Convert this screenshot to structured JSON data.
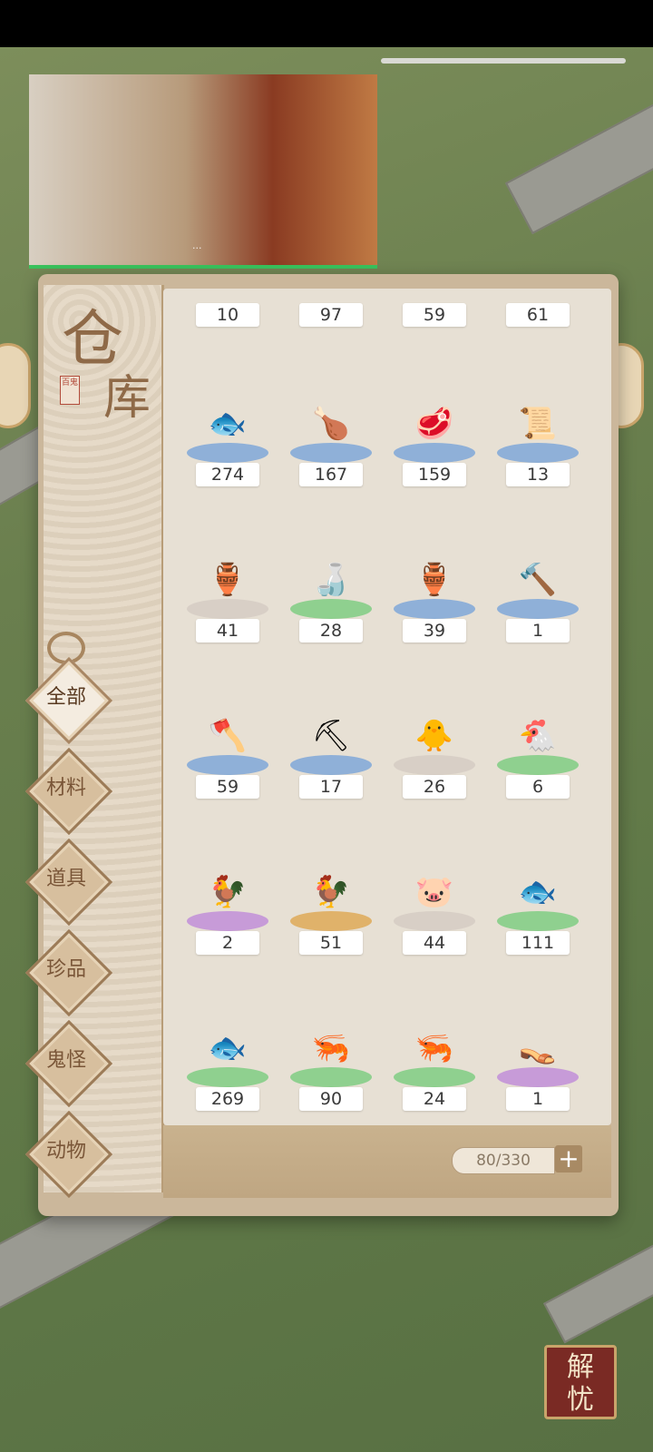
{
  "warehouse": {
    "title_char_1": "仓",
    "title_char_2": "库",
    "seal_text": "百鬼"
  },
  "tabs": [
    {
      "label": "全部",
      "active": true
    },
    {
      "label": "材料",
      "active": false
    },
    {
      "label": "道具",
      "active": false
    },
    {
      "label": "珍品",
      "active": false
    },
    {
      "label": "鬼怪",
      "active": false
    },
    {
      "label": "动物",
      "active": false
    }
  ],
  "partial_row_counts": [
    "10",
    "97",
    "59",
    "61"
  ],
  "items": [
    {
      "name": "fish-cut",
      "count": "274",
      "plate": "#8fb0d8",
      "icon": "🐟"
    },
    {
      "name": "roast-chicken",
      "count": "167",
      "plate": "#8fb0d8",
      "icon": "🍗"
    },
    {
      "name": "raw-meat",
      "count": "159",
      "plate": "#8fb0d8",
      "icon": "🥩"
    },
    {
      "name": "scroll",
      "count": "13",
      "plate": "#8fb0d8",
      "icon": "📜"
    },
    {
      "name": "wine-jug",
      "count": "41",
      "plate": "#d8cfc6",
      "icon": "🏺"
    },
    {
      "name": "green-gourd",
      "count": "28",
      "plate": "#8fd08f",
      "icon": "🍶"
    },
    {
      "name": "red-jar",
      "count": "39",
      "plate": "#8fb0d8",
      "icon": "🏺"
    },
    {
      "name": "hammer",
      "count": "1",
      "plate": "#8fb0d8",
      "icon": "🔨"
    },
    {
      "name": "axe",
      "count": "59",
      "plate": "#8fb0d8",
      "icon": "🪓"
    },
    {
      "name": "shovel",
      "count": "17",
      "plate": "#8fb0d8",
      "icon": "⛏"
    },
    {
      "name": "chick",
      "count": "26",
      "plate": "#d8cfc6",
      "icon": "🐥"
    },
    {
      "name": "hen",
      "count": "6",
      "plate": "#8fd08f",
      "icon": "🐔"
    },
    {
      "name": "rooster",
      "count": "2",
      "plate": "#c79bd8",
      "icon": "🐓"
    },
    {
      "name": "golden-rooster",
      "count": "51",
      "plate": "#e0b26a",
      "icon": "🐓"
    },
    {
      "name": "pig",
      "count": "44",
      "plate": "#d8cfc6",
      "icon": "🐷"
    },
    {
      "name": "blue-fish",
      "count": "111",
      "plate": "#8fd08f",
      "icon": "🐟"
    },
    {
      "name": "big-fish",
      "count": "269",
      "plate": "#8fd08f",
      "icon": "🐟"
    },
    {
      "name": "shrimp",
      "count": "90",
      "plate": "#8fd08f",
      "icon": "🦐"
    },
    {
      "name": "prawn",
      "count": "24",
      "plate": "#8fd08f",
      "icon": "🦐"
    },
    {
      "name": "straw-sandals",
      "count": "1",
      "plate": "#c79bd8",
      "icon": "👡"
    }
  ],
  "capacity": "80/330",
  "add_symbol": "+",
  "corner_badge": {
    "line1": "解",
    "line2": "忧"
  },
  "video": {
    "caption": "···"
  }
}
